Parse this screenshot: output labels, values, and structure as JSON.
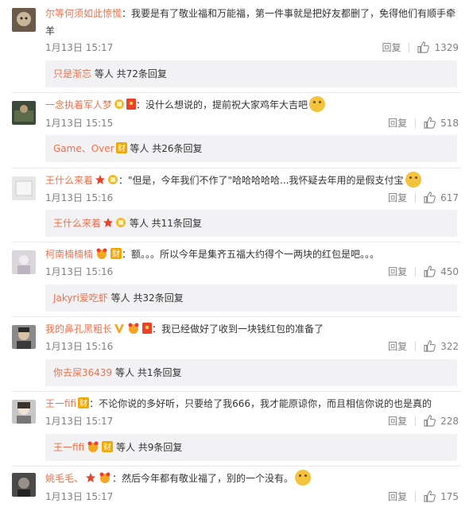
{
  "comments": [
    {
      "user": "尔等何须如此惊慌",
      "text": "：我要是有了敬业福和万能福，第一件事就是把好友都删了，免得他们有顺手牵羊",
      "time": "1月13日 15:17",
      "reply": "回复",
      "likes": "1329",
      "sub": {
        "user": "只是渐忘",
        "rest": " 等人 共72条回复"
      }
    },
    {
      "user": "一念执着军人梦",
      "text": "：没什么想说的，提前祝大家鸡年大吉吧",
      "time": "1月13日 15:15",
      "reply": "回复",
      "likes": "518",
      "sub": {
        "user": "Game、Over",
        "rest": " 等人 共26条回复"
      }
    },
    {
      "user": "王什么来着",
      "text": "：\"但是，今年我们不作了\"哈哈哈哈哈...我怀疑去年用的是假支付宝",
      "time": "1月13日 15:16",
      "reply": "回复",
      "likes": "617",
      "sub": {
        "user": "王什么来着",
        "rest": " 等人 共11条回复"
      }
    },
    {
      "user": "柯南楠楠楠",
      "text": "：额。。。所以今年是集齐五福大约得个一两块的红包是吧。。。",
      "time": "1月13日 15:16",
      "reply": "回复",
      "likes": "450",
      "sub": {
        "user": "Jakyri爱吃虾",
        "rest": " 等人 共32条回复"
      }
    },
    {
      "user": "我的鼻孔黑粗长",
      "text": "：我已经做好了收到一块钱红包的准备了",
      "time": "1月13日 15:16",
      "reply": "回复",
      "likes": "322",
      "sub": {
        "user": "你去屎36439",
        "rest": " 等人 共1条回复"
      }
    },
    {
      "user": "王一fifi",
      "text": "：不论你说的多好听，只要给了我666，我才能原谅你，而且相信你说的也是真的",
      "time": "1月13日 15:17",
      "reply": "回复",
      "likes": "228",
      "sub": {
        "user": "王一fifi",
        "rest": " 等人 共9条回复"
      }
    },
    {
      "user": "姚毛毛、",
      "text": "：然后今年都有敬业福了，别的一个没有。",
      "time": "1月13日 15:17",
      "reply": "回复",
      "likes": "175"
    }
  ]
}
